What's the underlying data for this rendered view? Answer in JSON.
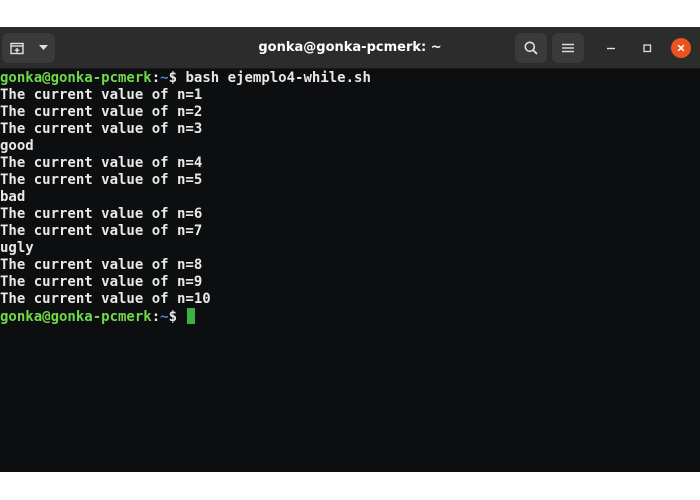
{
  "window": {
    "title": "gonka@gonka-pcmerk: ~"
  },
  "colors": {
    "prompt_user": "#72d94a",
    "cursor": "#3cb043",
    "close_button": "#e95420",
    "terminal_bg": "#0c0e10"
  },
  "icons": {
    "new_tab": "new-tab-icon",
    "menu_caret": "chevron-down-icon",
    "search": "search-icon",
    "menu": "hamburger-icon",
    "minimize": "minimize-icon",
    "maximize": "maximize-icon",
    "close": "close-icon"
  },
  "terminal": {
    "prompt": {
      "user_host": "gonka@gonka-pcmerk",
      "separator": ":",
      "path": "~",
      "symbol": "$"
    },
    "command": " bash ejemplo4-while.sh",
    "output": [
      "The current value of n=1",
      "The current value of n=2",
      "The current value of n=3",
      "good",
      "The current value of n=4",
      "The current value of n=5",
      "bad",
      "The current value of n=6",
      "The current value of n=7",
      "ugly",
      "The current value of n=8",
      "The current value of n=9",
      "The current value of n=10"
    ]
  }
}
